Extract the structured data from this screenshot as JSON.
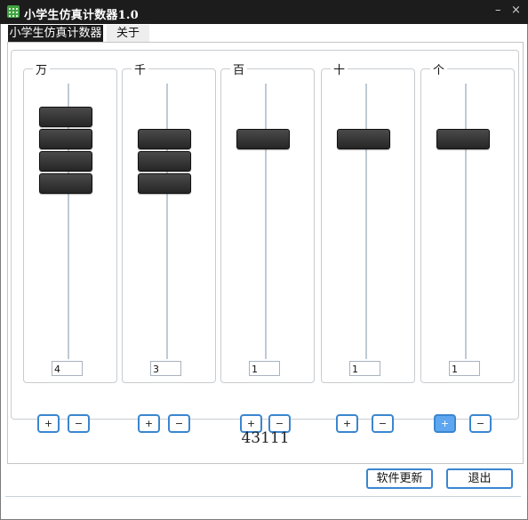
{
  "window": {
    "title": "小学生仿真计数器1.0",
    "minimize_glyph": "–",
    "close_glyph": "×"
  },
  "tabs": [
    {
      "label": "小学生仿真计数器",
      "active": true
    },
    {
      "label": "关于",
      "active": false
    }
  ],
  "columns": [
    {
      "label": "万",
      "beads": 4,
      "value": "4"
    },
    {
      "label": "千",
      "beads": 3,
      "value": "3"
    },
    {
      "label": "百",
      "beads": 1,
      "value": "1"
    },
    {
      "label": "十",
      "beads": 1,
      "value": "1"
    },
    {
      "label": "个",
      "beads": 1,
      "value": "1"
    }
  ],
  "controls": {
    "plus": "+",
    "minus": "−"
  },
  "total": "43111",
  "buttons": {
    "update": "软件更新",
    "exit": "退出"
  },
  "colors": {
    "accent": "#3a86d0",
    "bead": "#2e2e2e",
    "titlebar": "#1c1c1c",
    "hover": "#5ea6ef"
  }
}
